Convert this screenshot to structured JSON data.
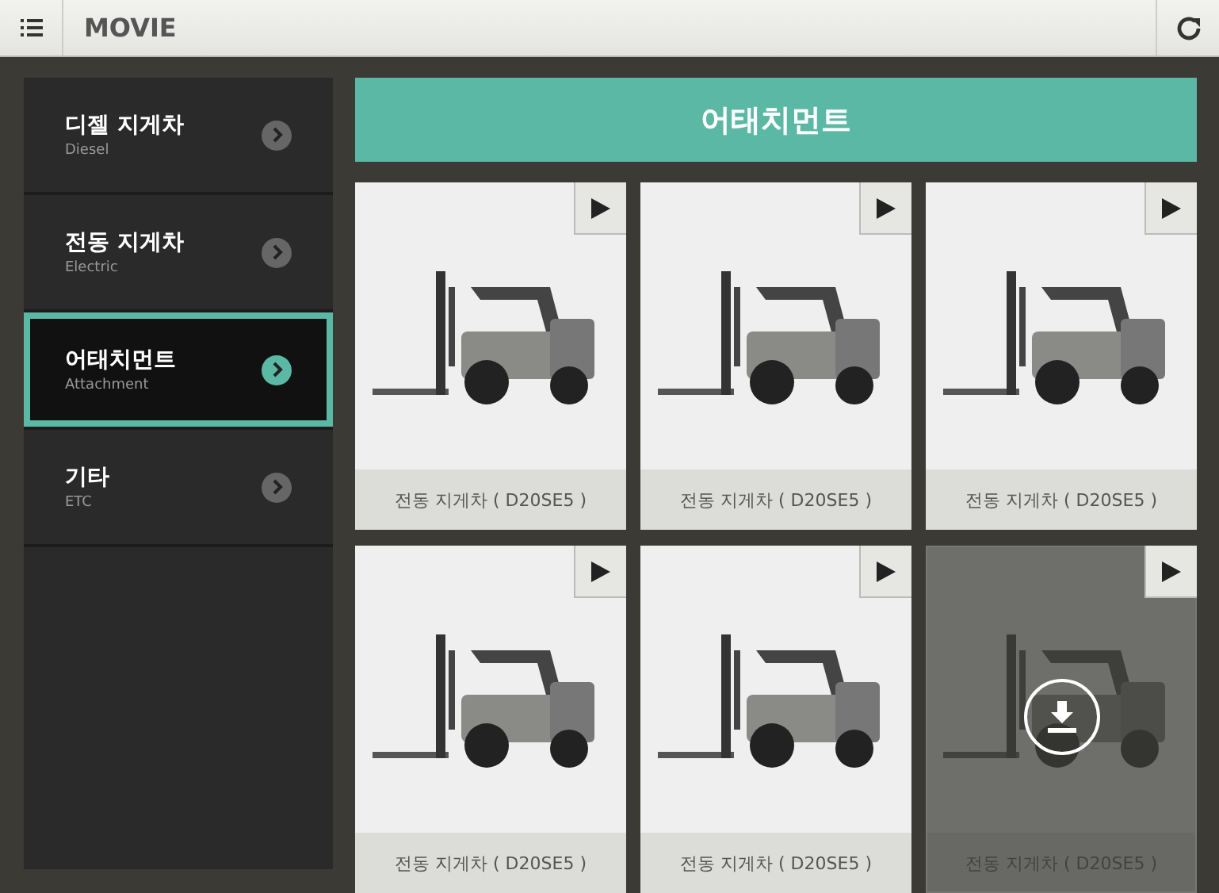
{
  "header": {
    "title": "MOVIE"
  },
  "sidebar": {
    "items": [
      {
        "title": "디젤 지게차",
        "subtitle": "Diesel",
        "selected": false
      },
      {
        "title": "전동 지게차",
        "subtitle": "Electric",
        "selected": false
      },
      {
        "title": "어태치먼트",
        "subtitle": "Attachment",
        "selected": true
      },
      {
        "title": "기타",
        "subtitle": "ETC",
        "selected": false
      }
    ]
  },
  "section": {
    "title": "어태치먼트"
  },
  "videos": [
    {
      "caption": "전동 지게차 ( D20SE5 )",
      "downloadable": false
    },
    {
      "caption": "전동 지게차 ( D20SE5 )",
      "downloadable": false
    },
    {
      "caption": "전동 지게차 ( D20SE5 )",
      "downloadable": false
    },
    {
      "caption": "전동 지게차 ( D20SE5 )",
      "downloadable": false
    },
    {
      "caption": "전동 지게차 ( D20SE5 )",
      "downloadable": false
    },
    {
      "caption": "전동 지게차 ( D20SE5 )",
      "downloadable": true
    }
  ]
}
